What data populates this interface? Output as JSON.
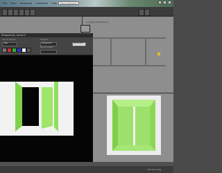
{
  "menubar": {
    "items": [
      "Edit",
      "Tools",
      "Group",
      "Views",
      "Create",
      "Modifiers",
      "Animation",
      "Graph Editors",
      "Rendering",
      "Customize",
      "MAXScript",
      "Help"
    ],
    "search_placeholder": "Type a keyword"
  },
  "viewports": {
    "perspective_label": "[+] [Top] [Wireframe]"
  },
  "render_window": {
    "title": "Perspective, frame 0",
    "area_to_render_label": "Area to Render:",
    "area_to_render_value": "View",
    "viewport_label": "Viewport:",
    "viewport_value": "Perspective",
    "render_preset_label": "Render Preset:",
    "render_preset_value": "",
    "production_value": "Production"
  },
  "status": {
    "add_time_tag": "Add Time Tag"
  },
  "colors": {
    "accent_green": "#8ee05a",
    "room_white": "#f2f2f2",
    "render_bg": "#050505"
  }
}
